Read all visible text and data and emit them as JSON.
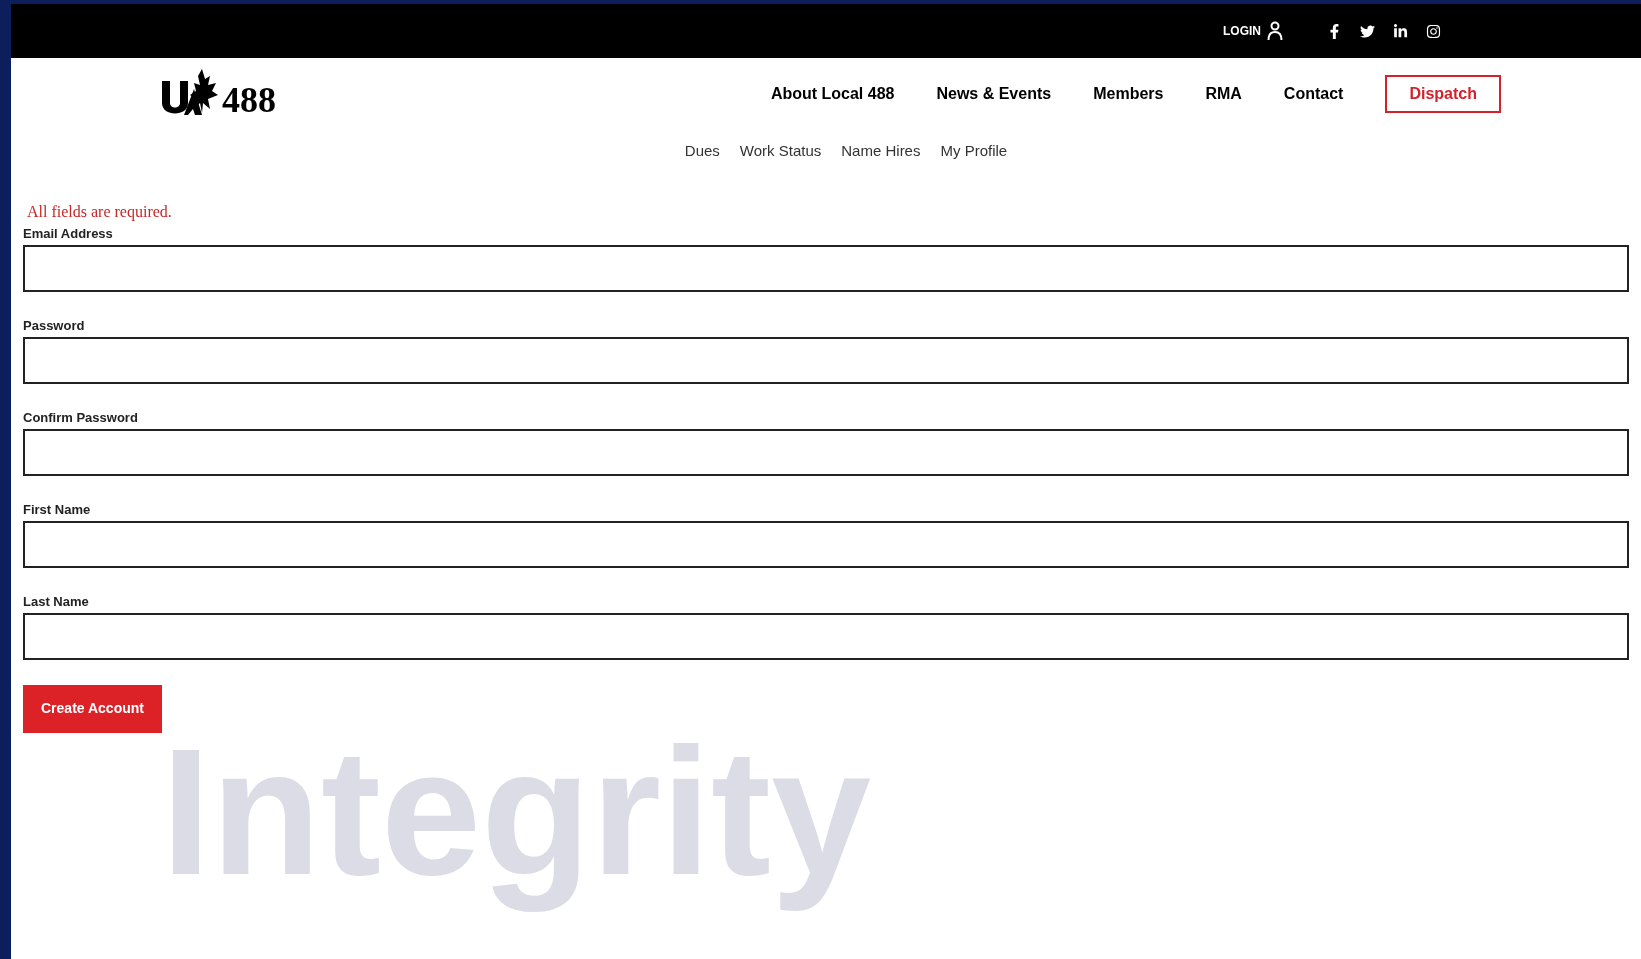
{
  "top_bar": {
    "login": "LOGIN",
    "social": [
      {
        "kind": "facebook"
      },
      {
        "kind": "twitter"
      },
      {
        "kind": "linkedin"
      },
      {
        "kind": "instagram"
      }
    ]
  },
  "header": {
    "logo_text": "488",
    "nav": [
      "About Local 488",
      "News & Events",
      "Members",
      "RMA",
      "Contact"
    ],
    "cta": "Dispatch"
  },
  "sub_nav": [
    "Dues",
    "Work Status",
    "Name Hires",
    "My Profile"
  ],
  "form": {
    "notice": "All fields are required.",
    "fields": [
      {
        "label": "Email Address"
      },
      {
        "label": "Password"
      },
      {
        "label": "Confirm Password"
      },
      {
        "label": "First Name"
      },
      {
        "label": "Last Name"
      }
    ],
    "submit": "Create Account"
  },
  "backdrop_words": [
    "Integrity"
  ]
}
